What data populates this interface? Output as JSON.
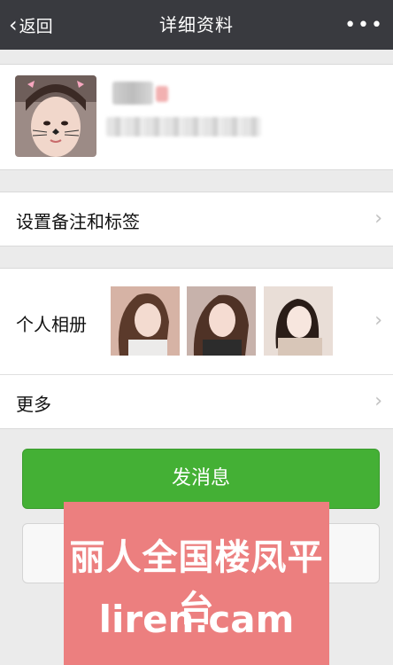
{
  "nav": {
    "back_label": "返回",
    "title": "详细资料",
    "more_label": "•••"
  },
  "rows": {
    "remark_label": "设置备注和标签",
    "album_label": "个人相册",
    "more_label": "更多",
    "arrow": "›"
  },
  "buttons": {
    "send_label": "发消息"
  },
  "watermark": {
    "line1": "丽人全国楼凤平台",
    "line2": "liren.cam"
  },
  "colors": {
    "nav_bg": "#393a3f",
    "page_bg": "#ebebeb",
    "send_button": "#44b035",
    "watermark_bg": "#ec7f7f"
  }
}
